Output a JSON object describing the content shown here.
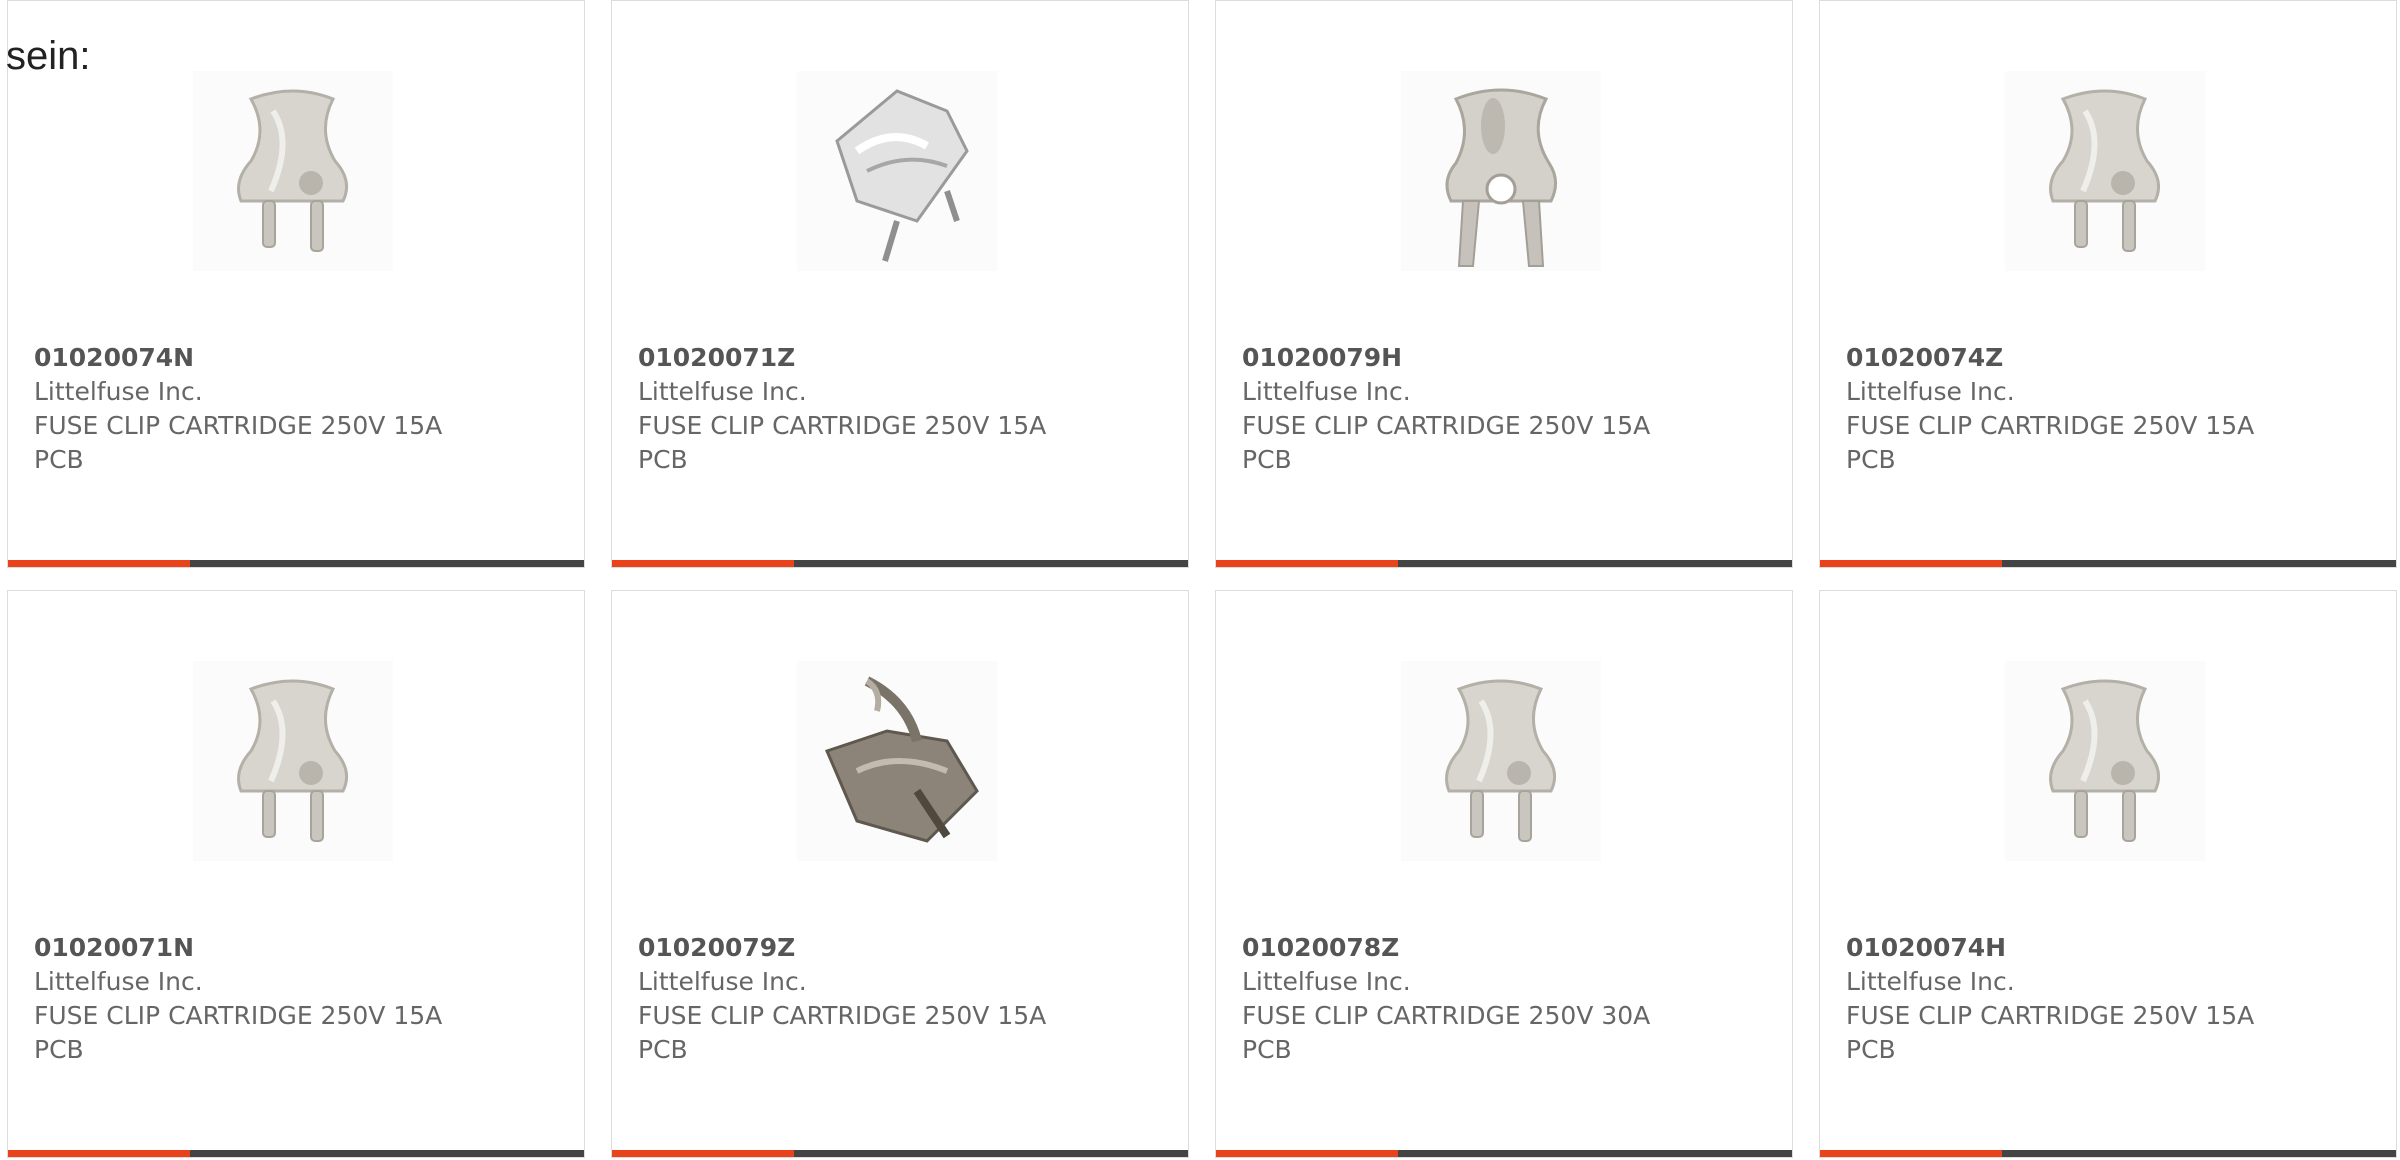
{
  "intro": {
    "text": "sein:"
  },
  "products": [
    {
      "part_number": "01020074N",
      "manufacturer": "Littelfuse Inc.",
      "description_line1": "FUSE CLIP CARTRIDGE 250V 15A",
      "description_line2": "PCB",
      "image_icon": "fuse-clip-straight-icon"
    },
    {
      "part_number": "01020071Z",
      "manufacturer": "Littelfuse Inc.",
      "description_line1": "FUSE CLIP CARTRIDGE 250V 15A",
      "description_line2": "PCB",
      "image_icon": "fuse-clip-angled-icon"
    },
    {
      "part_number": "01020079H",
      "manufacturer": "Littelfuse Inc.",
      "description_line1": "FUSE CLIP CARTRIDGE 250V 15A",
      "description_line2": "PCB",
      "image_icon": "fuse-clip-holed-icon"
    },
    {
      "part_number": "01020074Z",
      "manufacturer": "Littelfuse Inc.",
      "description_line1": "FUSE CLIP CARTRIDGE 250V 15A",
      "description_line2": "PCB",
      "image_icon": "fuse-clip-straight-icon"
    },
    {
      "part_number": "01020071N",
      "manufacturer": "Littelfuse Inc.",
      "description_line1": "FUSE CLIP CARTRIDGE 250V 15A",
      "description_line2": "PCB",
      "image_icon": "fuse-clip-straight-icon"
    },
    {
      "part_number": "01020079Z",
      "manufacturer": "Littelfuse Inc.",
      "description_line1": "FUSE CLIP CARTRIDGE 250V 15A",
      "description_line2": "PCB",
      "image_icon": "fuse-clip-dark-angled-icon"
    },
    {
      "part_number": "01020078Z",
      "manufacturer": "Littelfuse Inc.",
      "description_line1": "FUSE CLIP CARTRIDGE 250V 30A",
      "description_line2": "PCB",
      "image_icon": "fuse-clip-straight-icon"
    },
    {
      "part_number": "01020074H",
      "manufacturer": "Littelfuse Inc.",
      "description_line1": "FUSE CLIP CARTRIDGE 250V 15A",
      "description_line2": "PCB",
      "image_icon": "fuse-clip-straight-icon"
    }
  ],
  "colors": {
    "accent": "#e8431a",
    "bar": "#444444",
    "text": "#666666",
    "border": "#dcdcdc"
  }
}
